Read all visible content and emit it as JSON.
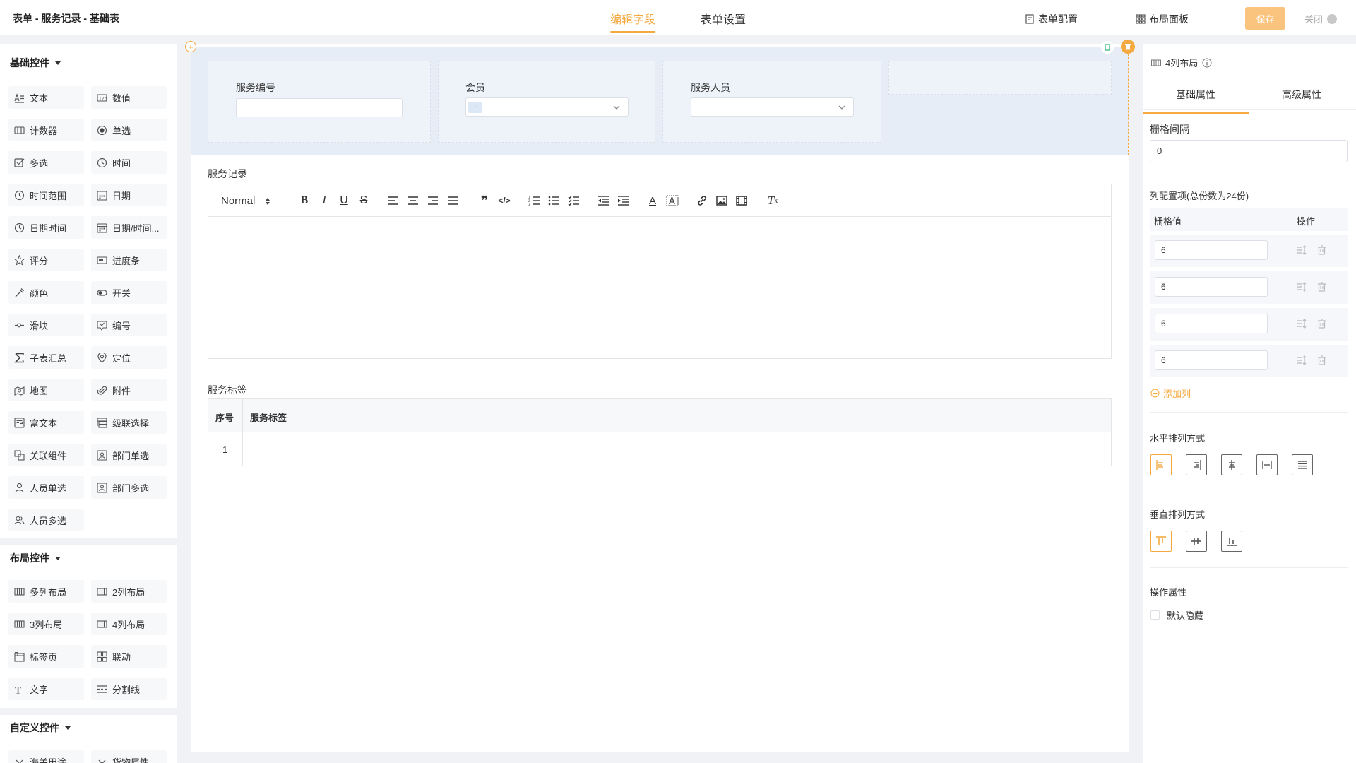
{
  "header": {
    "title": "表单 - 服务记录 - 基础表",
    "tab_edit": "编辑字段",
    "tab_settings": "表单设置",
    "form_config": "表单配置",
    "layout_panel": "布局面板",
    "save": "保存",
    "close": "关闭"
  },
  "left": {
    "basic_title": "基础控件",
    "basic": [
      {
        "label": "文本",
        "icon": "text-icon"
      },
      {
        "label": "数值",
        "icon": "number-icon"
      },
      {
        "label": "计数器",
        "icon": "counter-icon"
      },
      {
        "label": "单选",
        "icon": "radio-icon"
      },
      {
        "label": "多选",
        "icon": "checkbox-icon"
      },
      {
        "label": "时间",
        "icon": "clock-icon"
      },
      {
        "label": "时间范围",
        "icon": "clock-icon"
      },
      {
        "label": "日期",
        "icon": "calendar-icon"
      },
      {
        "label": "日期时间",
        "icon": "clock-icon"
      },
      {
        "label": "日期/时间...",
        "icon": "calendar-icon"
      },
      {
        "label": "评分",
        "icon": "star-icon"
      },
      {
        "label": "进度条",
        "icon": "progress-icon"
      },
      {
        "label": "颜色",
        "icon": "color-icon"
      },
      {
        "label": "开关",
        "icon": "switch-icon"
      },
      {
        "label": "滑块",
        "icon": "slider-icon"
      },
      {
        "label": "编号",
        "icon": "serial-icon"
      },
      {
        "label": "子表汇总",
        "icon": "sigma-icon"
      },
      {
        "label": "定位",
        "icon": "location-icon"
      },
      {
        "label": "地图",
        "icon": "map-icon"
      },
      {
        "label": "附件",
        "icon": "paperclip-icon"
      },
      {
        "label": "富文本",
        "icon": "richtext-icon"
      },
      {
        "label": "级联选择",
        "icon": "cascade-icon"
      },
      {
        "label": "关联组件",
        "icon": "link-component-icon"
      },
      {
        "label": "部门单选",
        "icon": "department-icon"
      },
      {
        "label": "人员单选",
        "icon": "person-icon"
      },
      {
        "label": "部门多选",
        "icon": "department-icon"
      },
      {
        "label": "人员多选",
        "icon": "people-icon"
      }
    ],
    "layout_title": "布局控件",
    "layout": [
      {
        "label": "多列布局",
        "icon": "columns-icon"
      },
      {
        "label": "2列布局",
        "icon": "columns-icon"
      },
      {
        "label": "3列布局",
        "icon": "columns-icon"
      },
      {
        "label": "4列布局",
        "icon": "columns-icon"
      },
      {
        "label": "标签页",
        "icon": "tabs-icon"
      },
      {
        "label": "联动",
        "icon": "grid-icon"
      },
      {
        "label": "文字",
        "icon": "text-t-icon"
      },
      {
        "label": "分割线",
        "icon": "divider-icon"
      }
    ],
    "custom_title": "自定义控件",
    "custom": [
      {
        "label": "海关用途",
        "icon": "chevron-down-icon"
      },
      {
        "label": "货物属性",
        "icon": "chevron-down-icon"
      }
    ]
  },
  "canvas": {
    "field1_label": "服务编号",
    "field2_label": "会员",
    "field2_tag": "-",
    "field3_label": "服务人员",
    "record_label": "服务记录",
    "editor_format": "Normal",
    "tags_label": "服务标签",
    "table_headers": [
      "序号",
      "服务标签"
    ],
    "table_rows": [
      [
        "1",
        ""
      ]
    ]
  },
  "right": {
    "title": "4列布局",
    "tab_basic": "基础属性",
    "tab_advanced": "高级属性",
    "gutter_label": "栅格间隔",
    "gutter_value": "0",
    "cols_label": "列配置项(总份数为24份)",
    "col_header_value": "栅格值",
    "col_header_ops": "操作",
    "cols": [
      "6",
      "6",
      "6",
      "6"
    ],
    "add_col": "添加列",
    "h_align_label": "水平排列方式",
    "v_align_label": "垂直排列方式",
    "ops_label": "操作属性",
    "hidden_label": "默认隐藏"
  },
  "colors": {
    "accent": "#f5a941",
    "save_bg": "#fbc47e",
    "layout_bg": "#e6edf7"
  }
}
